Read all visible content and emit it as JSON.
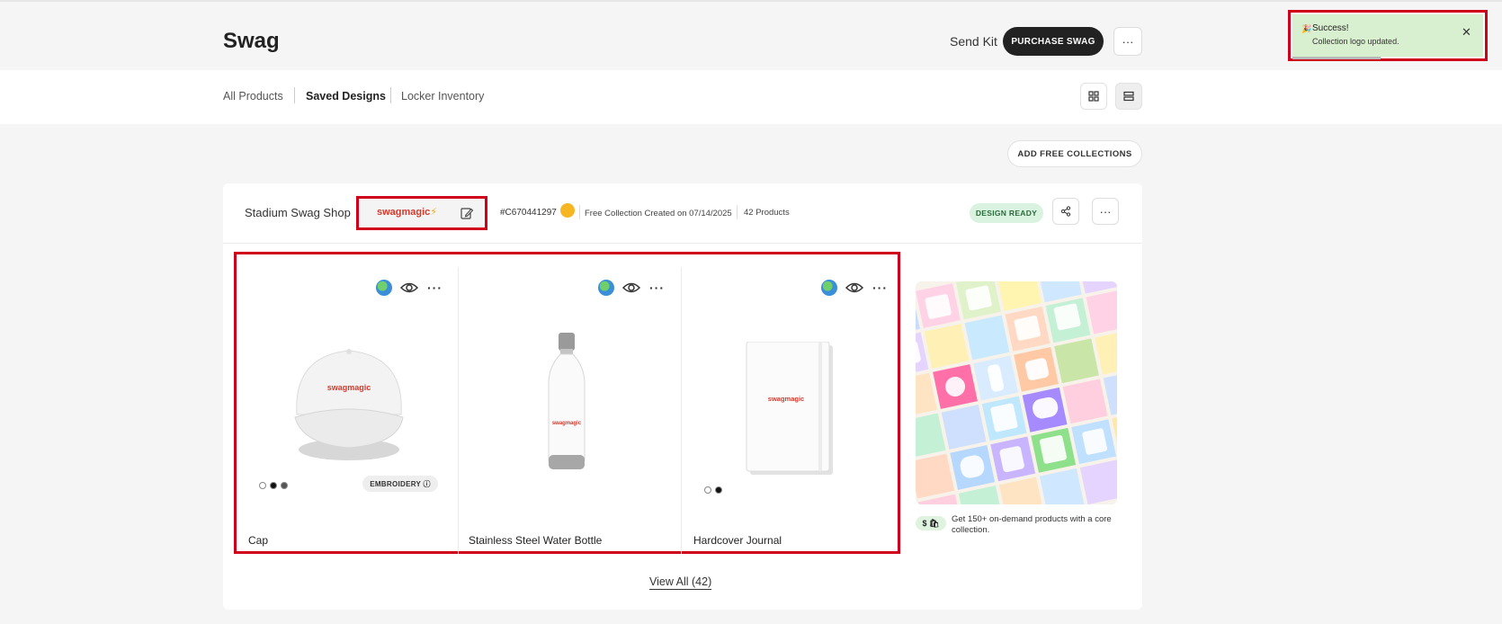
{
  "header": {
    "title": "Swag",
    "send_kit": "Send Kit",
    "purchase_label": "PURCHASE SWAG",
    "more_label": "···"
  },
  "tabs": [
    {
      "label": "All Products",
      "active": false
    },
    {
      "label": "Saved Designs",
      "active": true
    },
    {
      "label": "Locker Inventory",
      "active": false
    }
  ],
  "add_free_label": "ADD FREE COLLECTIONS",
  "collection": {
    "name": "Stadium Swag Shop",
    "logo_text": "swagmagic",
    "logo_spark": "⚡",
    "id": "#C670441297",
    "created": "Free Collection Created on 07/14/2025",
    "count": "42 Products",
    "status": "DESIGN READY",
    "more_label": "···",
    "view_all": "View All (42)"
  },
  "products": [
    {
      "name": "Cap",
      "logo": "swagmagic",
      "badge": "EMBROIDERY ⓘ",
      "more": "···"
    },
    {
      "name": "Stainless Steel Water Bottle",
      "logo": "swagmagic",
      "more": "···"
    },
    {
      "name": "Hardcover Journal",
      "logo": "swagmagic",
      "more": "···"
    }
  ],
  "promo": {
    "tag": "$ 🛍",
    "text": "Get 150+ on-demand products with a core collection."
  },
  "toast": {
    "title": "Success!",
    "message": "Collection logo updated.",
    "close": "✕",
    "icon": "🎉"
  },
  "colors": {
    "accent_dark": "#222222",
    "highlight_red": "#d0021b",
    "status_green": "#d9f3e0",
    "toast_green": "#d8f0cf",
    "logo_red": "#d33a2c"
  }
}
